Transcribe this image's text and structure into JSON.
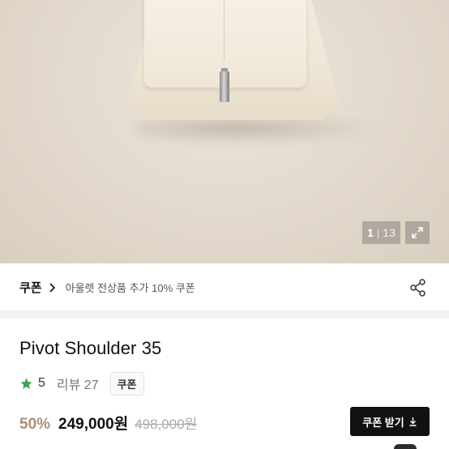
{
  "gallery": {
    "current": "1",
    "total": "13"
  },
  "coupon": {
    "label": "쿠폰",
    "description": "아울렛 전상품 추가 10% 쿠폰"
  },
  "product": {
    "title": "Pivot Shoulder 35",
    "rating": "5",
    "reviews": "리뷰 27",
    "coupon_tag": "쿠폰",
    "discount": "50%",
    "price": "249,000원",
    "original_price": "498,000원",
    "get_coupon_label": "쿠폰 받기"
  },
  "icons": {
    "star": "star-icon",
    "chevron": "chevron-right-icon",
    "share": "share-icon",
    "expand": "expand-icon",
    "download": "download-icon"
  },
  "colors": {
    "star": "#3aa657",
    "discount": "#b08d78",
    "button_bg": "#111111"
  }
}
